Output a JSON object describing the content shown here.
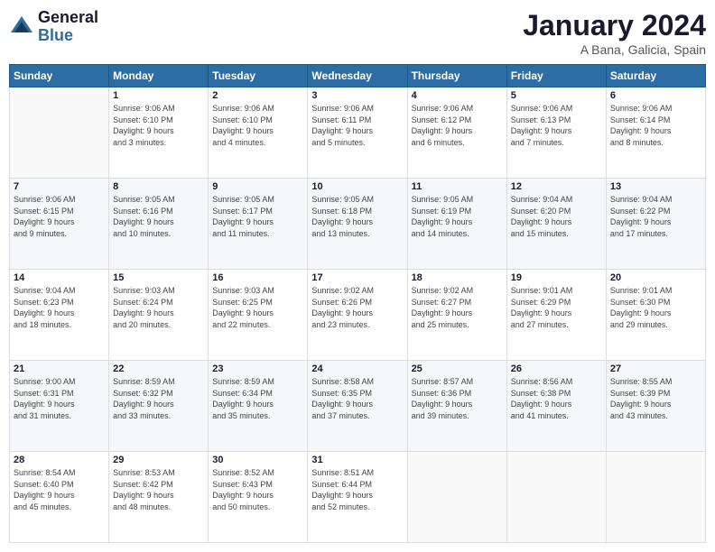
{
  "header": {
    "logo_general": "General",
    "logo_blue": "Blue",
    "month": "January 2024",
    "location": "A Bana, Galicia, Spain"
  },
  "weekdays": [
    "Sunday",
    "Monday",
    "Tuesday",
    "Wednesday",
    "Thursday",
    "Friday",
    "Saturday"
  ],
  "weeks": [
    [
      {
        "day": "",
        "info": ""
      },
      {
        "day": "1",
        "info": "Sunrise: 9:06 AM\nSunset: 6:10 PM\nDaylight: 9 hours\nand 3 minutes."
      },
      {
        "day": "2",
        "info": "Sunrise: 9:06 AM\nSunset: 6:10 PM\nDaylight: 9 hours\nand 4 minutes."
      },
      {
        "day": "3",
        "info": "Sunrise: 9:06 AM\nSunset: 6:11 PM\nDaylight: 9 hours\nand 5 minutes."
      },
      {
        "day": "4",
        "info": "Sunrise: 9:06 AM\nSunset: 6:12 PM\nDaylight: 9 hours\nand 6 minutes."
      },
      {
        "day": "5",
        "info": "Sunrise: 9:06 AM\nSunset: 6:13 PM\nDaylight: 9 hours\nand 7 minutes."
      },
      {
        "day": "6",
        "info": "Sunrise: 9:06 AM\nSunset: 6:14 PM\nDaylight: 9 hours\nand 8 minutes."
      }
    ],
    [
      {
        "day": "7",
        "info": "Sunrise: 9:06 AM\nSunset: 6:15 PM\nDaylight: 9 hours\nand 9 minutes."
      },
      {
        "day": "8",
        "info": "Sunrise: 9:05 AM\nSunset: 6:16 PM\nDaylight: 9 hours\nand 10 minutes."
      },
      {
        "day": "9",
        "info": "Sunrise: 9:05 AM\nSunset: 6:17 PM\nDaylight: 9 hours\nand 11 minutes."
      },
      {
        "day": "10",
        "info": "Sunrise: 9:05 AM\nSunset: 6:18 PM\nDaylight: 9 hours\nand 13 minutes."
      },
      {
        "day": "11",
        "info": "Sunrise: 9:05 AM\nSunset: 6:19 PM\nDaylight: 9 hours\nand 14 minutes."
      },
      {
        "day": "12",
        "info": "Sunrise: 9:04 AM\nSunset: 6:20 PM\nDaylight: 9 hours\nand 15 minutes."
      },
      {
        "day": "13",
        "info": "Sunrise: 9:04 AM\nSunset: 6:22 PM\nDaylight: 9 hours\nand 17 minutes."
      }
    ],
    [
      {
        "day": "14",
        "info": "Sunrise: 9:04 AM\nSunset: 6:23 PM\nDaylight: 9 hours\nand 18 minutes."
      },
      {
        "day": "15",
        "info": "Sunrise: 9:03 AM\nSunset: 6:24 PM\nDaylight: 9 hours\nand 20 minutes."
      },
      {
        "day": "16",
        "info": "Sunrise: 9:03 AM\nSunset: 6:25 PM\nDaylight: 9 hours\nand 22 minutes."
      },
      {
        "day": "17",
        "info": "Sunrise: 9:02 AM\nSunset: 6:26 PM\nDaylight: 9 hours\nand 23 minutes."
      },
      {
        "day": "18",
        "info": "Sunrise: 9:02 AM\nSunset: 6:27 PM\nDaylight: 9 hours\nand 25 minutes."
      },
      {
        "day": "19",
        "info": "Sunrise: 9:01 AM\nSunset: 6:29 PM\nDaylight: 9 hours\nand 27 minutes."
      },
      {
        "day": "20",
        "info": "Sunrise: 9:01 AM\nSunset: 6:30 PM\nDaylight: 9 hours\nand 29 minutes."
      }
    ],
    [
      {
        "day": "21",
        "info": "Sunrise: 9:00 AM\nSunset: 6:31 PM\nDaylight: 9 hours\nand 31 minutes."
      },
      {
        "day": "22",
        "info": "Sunrise: 8:59 AM\nSunset: 6:32 PM\nDaylight: 9 hours\nand 33 minutes."
      },
      {
        "day": "23",
        "info": "Sunrise: 8:59 AM\nSunset: 6:34 PM\nDaylight: 9 hours\nand 35 minutes."
      },
      {
        "day": "24",
        "info": "Sunrise: 8:58 AM\nSunset: 6:35 PM\nDaylight: 9 hours\nand 37 minutes."
      },
      {
        "day": "25",
        "info": "Sunrise: 8:57 AM\nSunset: 6:36 PM\nDaylight: 9 hours\nand 39 minutes."
      },
      {
        "day": "26",
        "info": "Sunrise: 8:56 AM\nSunset: 6:38 PM\nDaylight: 9 hours\nand 41 minutes."
      },
      {
        "day": "27",
        "info": "Sunrise: 8:55 AM\nSunset: 6:39 PM\nDaylight: 9 hours\nand 43 minutes."
      }
    ],
    [
      {
        "day": "28",
        "info": "Sunrise: 8:54 AM\nSunset: 6:40 PM\nDaylight: 9 hours\nand 45 minutes."
      },
      {
        "day": "29",
        "info": "Sunrise: 8:53 AM\nSunset: 6:42 PM\nDaylight: 9 hours\nand 48 minutes."
      },
      {
        "day": "30",
        "info": "Sunrise: 8:52 AM\nSunset: 6:43 PM\nDaylight: 9 hours\nand 50 minutes."
      },
      {
        "day": "31",
        "info": "Sunrise: 8:51 AM\nSunset: 6:44 PM\nDaylight: 9 hours\nand 52 minutes."
      },
      {
        "day": "",
        "info": ""
      },
      {
        "day": "",
        "info": ""
      },
      {
        "day": "",
        "info": ""
      }
    ]
  ]
}
